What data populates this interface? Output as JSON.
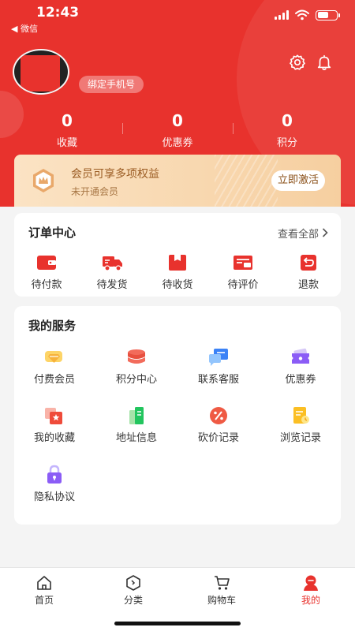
{
  "status_bar": {
    "time": "12:43",
    "back_label": "◀ 微信"
  },
  "profile": {
    "bind_phone_label": "绑定手机号"
  },
  "stats": [
    {
      "value": "0",
      "label": "收藏"
    },
    {
      "value": "0",
      "label": "优惠券"
    },
    {
      "value": "0",
      "label": "积分"
    }
  ],
  "vip": {
    "title": "会员可享多项权益",
    "subtitle": "未开通会员",
    "button": "立即激活"
  },
  "orders": {
    "title": "订单中心",
    "view_all": "查看全部",
    "items": [
      {
        "label": "待付款",
        "icon": "wallet-icon"
      },
      {
        "label": "待发货",
        "icon": "truck-icon"
      },
      {
        "label": "待收货",
        "icon": "package-icon"
      },
      {
        "label": "待评价",
        "icon": "review-icon"
      },
      {
        "label": "退款",
        "icon": "refund-icon"
      }
    ]
  },
  "services": {
    "title": "我的服务",
    "items": [
      {
        "label": "付费会员",
        "icon": "diamond-icon"
      },
      {
        "label": "积分中心",
        "icon": "coins-icon"
      },
      {
        "label": "联系客服",
        "icon": "chat-icon"
      },
      {
        "label": "优惠券",
        "icon": "coupon-icon"
      },
      {
        "label": "我的收藏",
        "icon": "star-icon"
      },
      {
        "label": "地址信息",
        "icon": "address-icon"
      },
      {
        "label": "砍价记录",
        "icon": "discount-icon"
      },
      {
        "label": "浏览记录",
        "icon": "history-icon"
      },
      {
        "label": "隐私协议",
        "icon": "lock-icon"
      }
    ]
  },
  "tabs": [
    {
      "label": "首页",
      "icon": "home-icon"
    },
    {
      "label": "分类",
      "icon": "category-icon"
    },
    {
      "label": "购物车",
      "icon": "cart-icon"
    },
    {
      "label": "我的",
      "icon": "profile-icon",
      "active": true
    }
  ],
  "colors": {
    "brand_red": "#e8322d",
    "vip_gold": "#f6cfa0",
    "vip_text": "#9a5b22",
    "background": "#f4f4f4"
  }
}
